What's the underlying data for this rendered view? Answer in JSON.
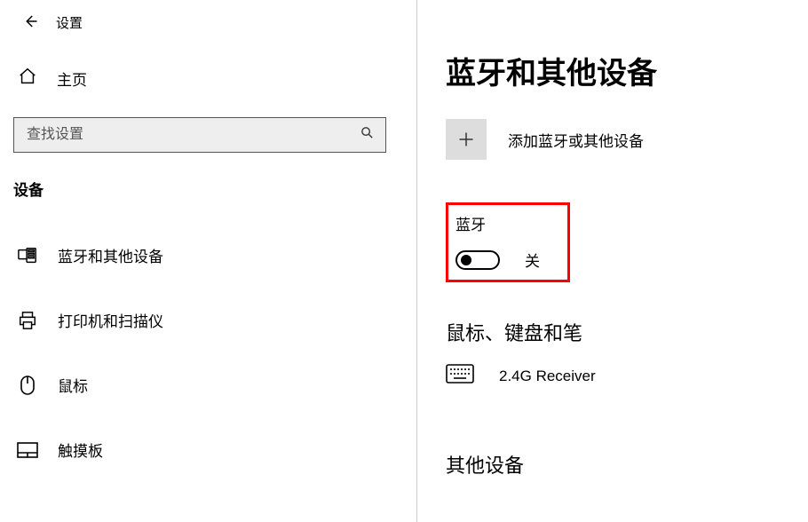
{
  "titlebar": {
    "title": "设置"
  },
  "sidebar": {
    "home_label": "主页",
    "search_placeholder": "查找设置",
    "category": "设备",
    "items": [
      {
        "label": "蓝牙和其他设备"
      },
      {
        "label": "打印机和扫描仪"
      },
      {
        "label": "鼠标"
      },
      {
        "label": "触摸板"
      }
    ]
  },
  "main": {
    "page_title": "蓝牙和其他设备",
    "add_device_label": "添加蓝牙或其他设备",
    "bluetooth_label": "蓝牙",
    "bluetooth_state": "关",
    "section_mouse_kb": "鼠标、键盘和笔",
    "device1": "2.4G Receiver",
    "section_other": "其他设备"
  },
  "annotation": {
    "highlight_color": "#ff0000"
  }
}
